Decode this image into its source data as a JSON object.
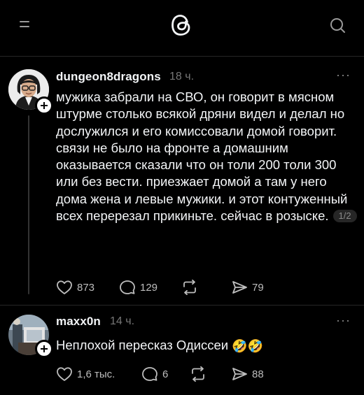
{
  "header": {
    "menu_icon": "menu-icon",
    "logo_icon": "threads-logo-icon",
    "search_icon": "search-icon"
  },
  "posts": [
    {
      "username": "dungeon8dragons",
      "time": "18 ч.",
      "more": "···",
      "text": "мужика забрали на СВО, он говорит в мясном штурме столько всякой дряни видел и делал но дослужился и его комиссовали домой говорит. связи не было на фронте а домашним оказывается сказали что он толи 200 толи 300 или без вести. приезжает домой а там у него дома жена и левые мужики. и этот контуженный всех перерезал прикиньте. сейчас в розыске.",
      "pager": "1/2",
      "likes": "873",
      "comments": "129",
      "reposts": "",
      "shares": "79"
    },
    {
      "username": "maxx0n",
      "time": "14 ч.",
      "more": "···",
      "text": "Неплохой пересказ Одиссеи",
      "emoji": "🤣🤣",
      "likes": "1,6 тыс.",
      "comments": "6",
      "reposts": "",
      "shares": "88"
    }
  ],
  "colors": {
    "background": "#000000",
    "text": "#f3f5f7",
    "muted": "#777777",
    "divider": "#262626"
  }
}
